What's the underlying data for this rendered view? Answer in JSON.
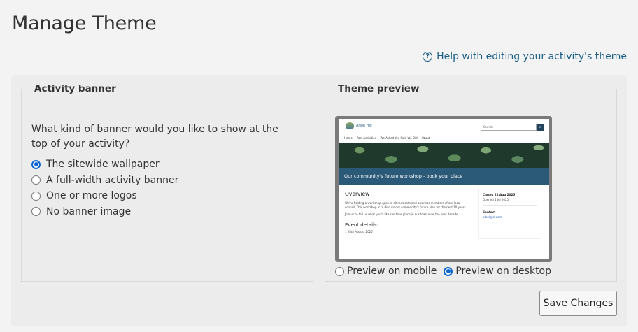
{
  "page": {
    "title": "Manage Theme"
  },
  "help": {
    "icon": "question-circle-icon",
    "label": "Help with editing your activity's theme"
  },
  "banner": {
    "legend": "Activity banner",
    "question": "What kind of banner would you like to show at the top of your activity?",
    "options": [
      {
        "label": "The sitewide wallpaper",
        "checked": true
      },
      {
        "label": "A full-width activity banner",
        "checked": false
      },
      {
        "label": "One or more logos",
        "checked": false
      },
      {
        "label": "No banner image",
        "checked": false
      }
    ]
  },
  "preview": {
    "legend": "Theme preview",
    "mini": {
      "logo_text": "Arion Hill",
      "search_placeholder": "Search",
      "nav": [
        "Home",
        "Past Activities",
        "We Asked You Said We Did",
        "About"
      ],
      "hero_title": "Our community's future workshop - book your place",
      "overview_title": "Overview",
      "overview_p1": "We're holding a workshop open to all residents and business members of our local council. This workshop is to discuss our community's future plan for the next 10 years.",
      "overview_p2": "Join us to tell us what you'd like see take place in our town over the next decade.",
      "event_title": "Event details:",
      "event_date": "1 28th August 2025",
      "closes": "Closes 22 Aug 2025",
      "opened": "Opened 1 Jul 2025",
      "contact_label": "Contact",
      "contact_email": "arbel@cl.com"
    },
    "toggle": [
      {
        "label": "Preview on mobile",
        "checked": false
      },
      {
        "label": "Preview on desktop",
        "checked": true
      }
    ]
  },
  "actions": {
    "save_label": "Save Changes"
  }
}
